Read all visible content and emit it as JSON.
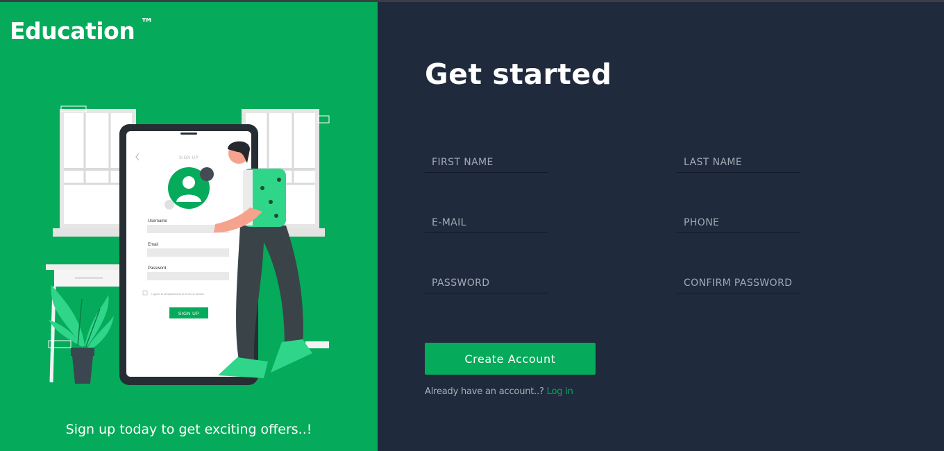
{
  "brand": {
    "name": "Education",
    "trademark": "™"
  },
  "left_panel": {
    "tagline": "Sign up today to get exciting offers..!",
    "illustration": {
      "screen_title": "SIGN UP",
      "username_label": "Username",
      "email_label": "Email",
      "password_label": "Password",
      "terms_text": "I agree to all statements in terms of service",
      "button_label": "SIGN UP"
    }
  },
  "form": {
    "title": "Get started",
    "fields": {
      "first_name": {
        "placeholder": "FIRST NAME",
        "value": ""
      },
      "last_name": {
        "placeholder": "LAST NAME",
        "value": ""
      },
      "email": {
        "placeholder": "E-MAIL",
        "value": ""
      },
      "phone": {
        "placeholder": "PHONE",
        "value": ""
      },
      "password": {
        "placeholder": "PASSWORD",
        "value": ""
      },
      "confirm_password": {
        "placeholder": "CONFIRM PASSWORD",
        "value": ""
      }
    },
    "submit_label": "Create Account",
    "login_prompt": "Already have an account..?",
    "login_link": "Log in"
  },
  "colors": {
    "accent_green": "#05ab5a",
    "panel_dark": "#1f2a3c",
    "text_white": "#ffffff",
    "muted_text": "#a9b0ba"
  }
}
